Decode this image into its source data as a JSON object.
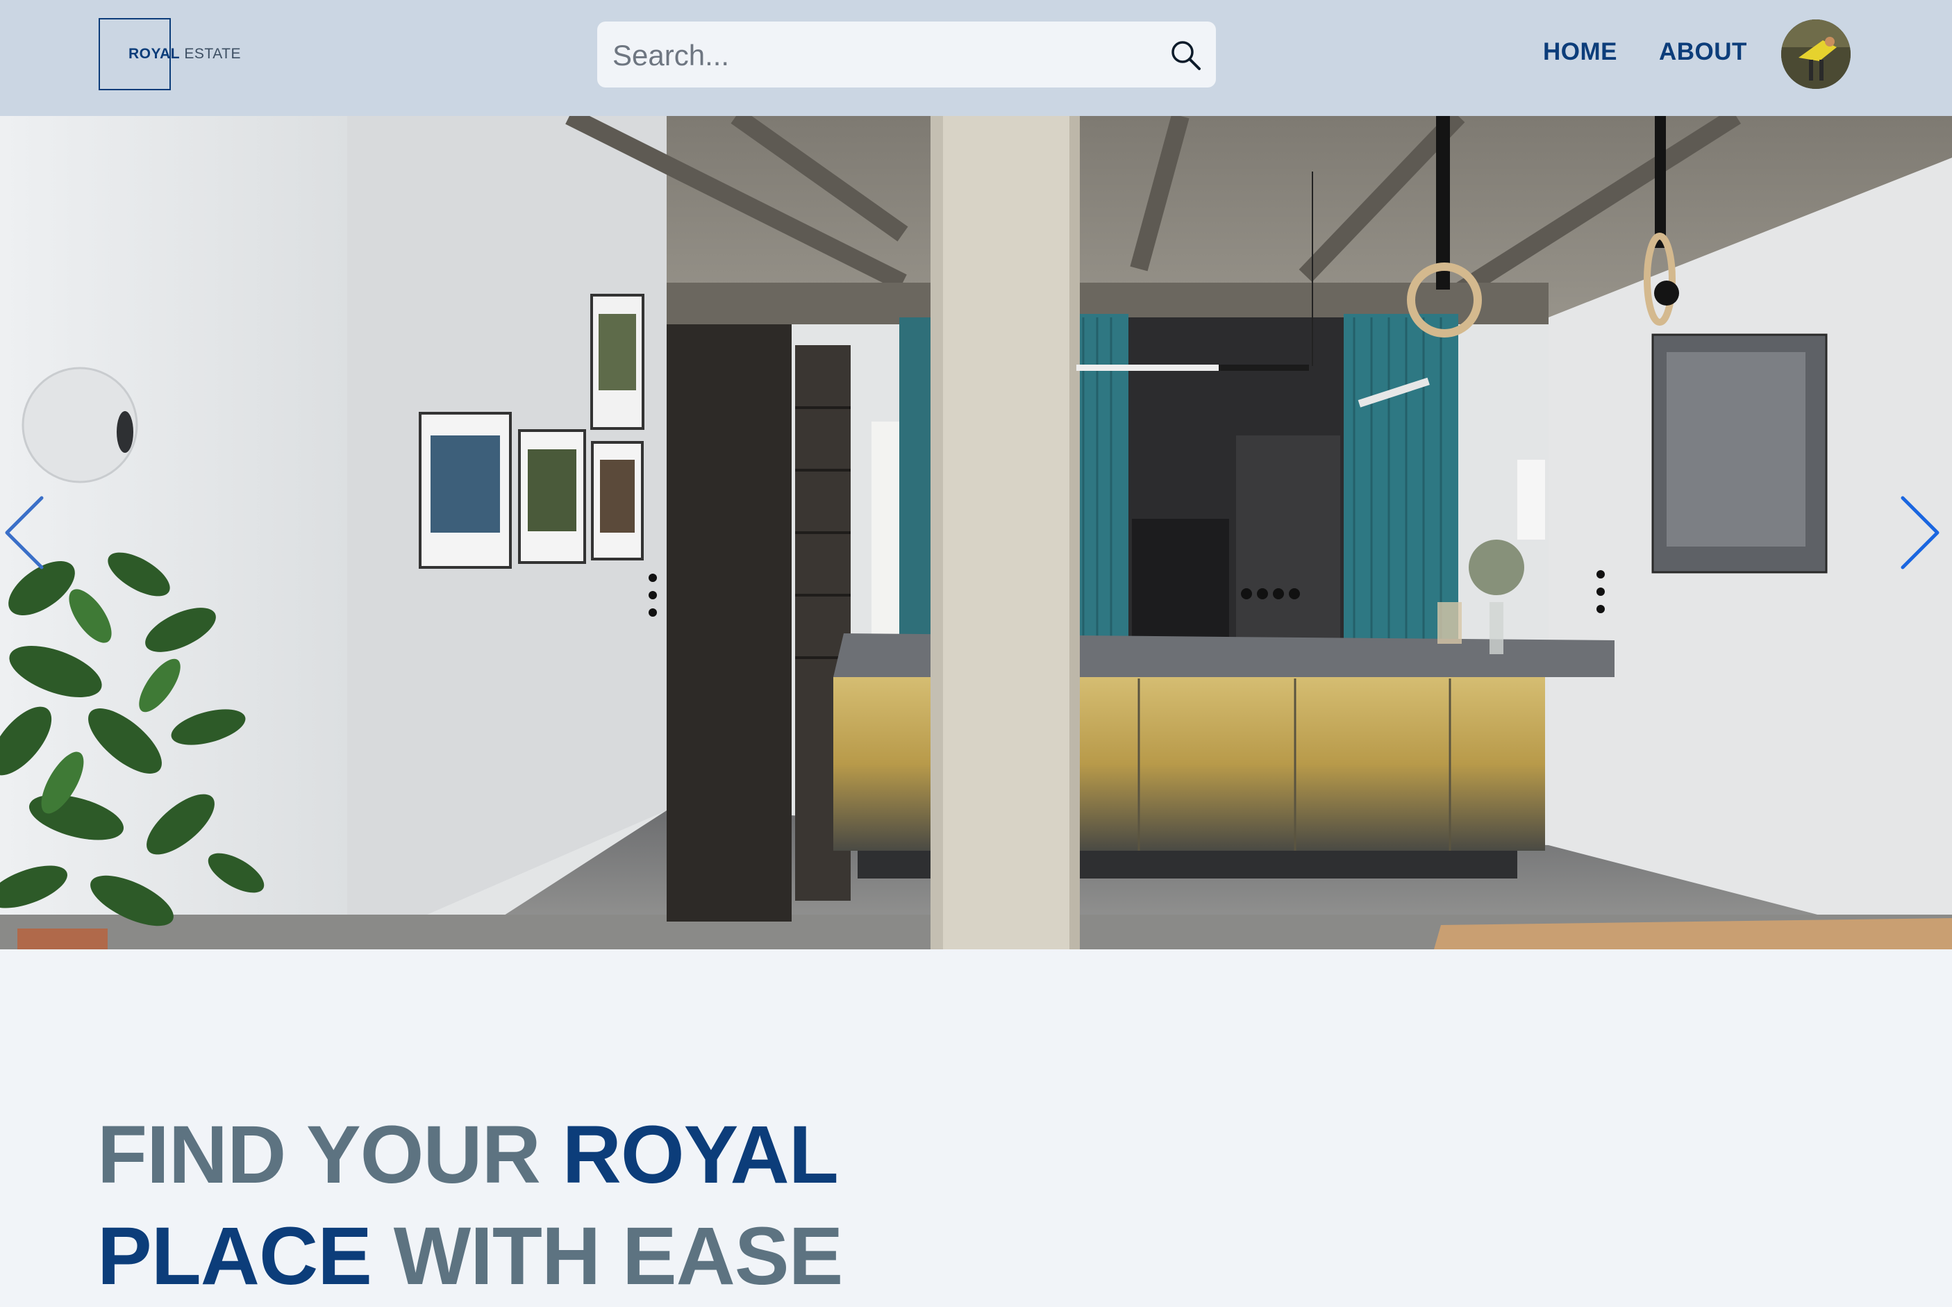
{
  "header": {
    "logo": {
      "royal": "ROYAL",
      "estate": "ESTATE"
    },
    "search": {
      "placeholder": "Search..."
    },
    "nav": [
      {
        "label": "HOME"
      },
      {
        "label": "ABOUT"
      }
    ],
    "colors": {
      "background": "#cbd6e3",
      "accent": "#0c3d7a"
    }
  },
  "hero": {
    "image": "modern loft kitchen with concrete pillar, teal panels, brass island",
    "icons": {
      "prev": "chevron-left-icon",
      "next": "chevron-right-icon"
    }
  },
  "headline": {
    "line1_part1": "FIND YOUR",
    "line1_part2": "ROYAL",
    "line2_part1": "PLACE",
    "line2_part2": "WITH EASE"
  }
}
